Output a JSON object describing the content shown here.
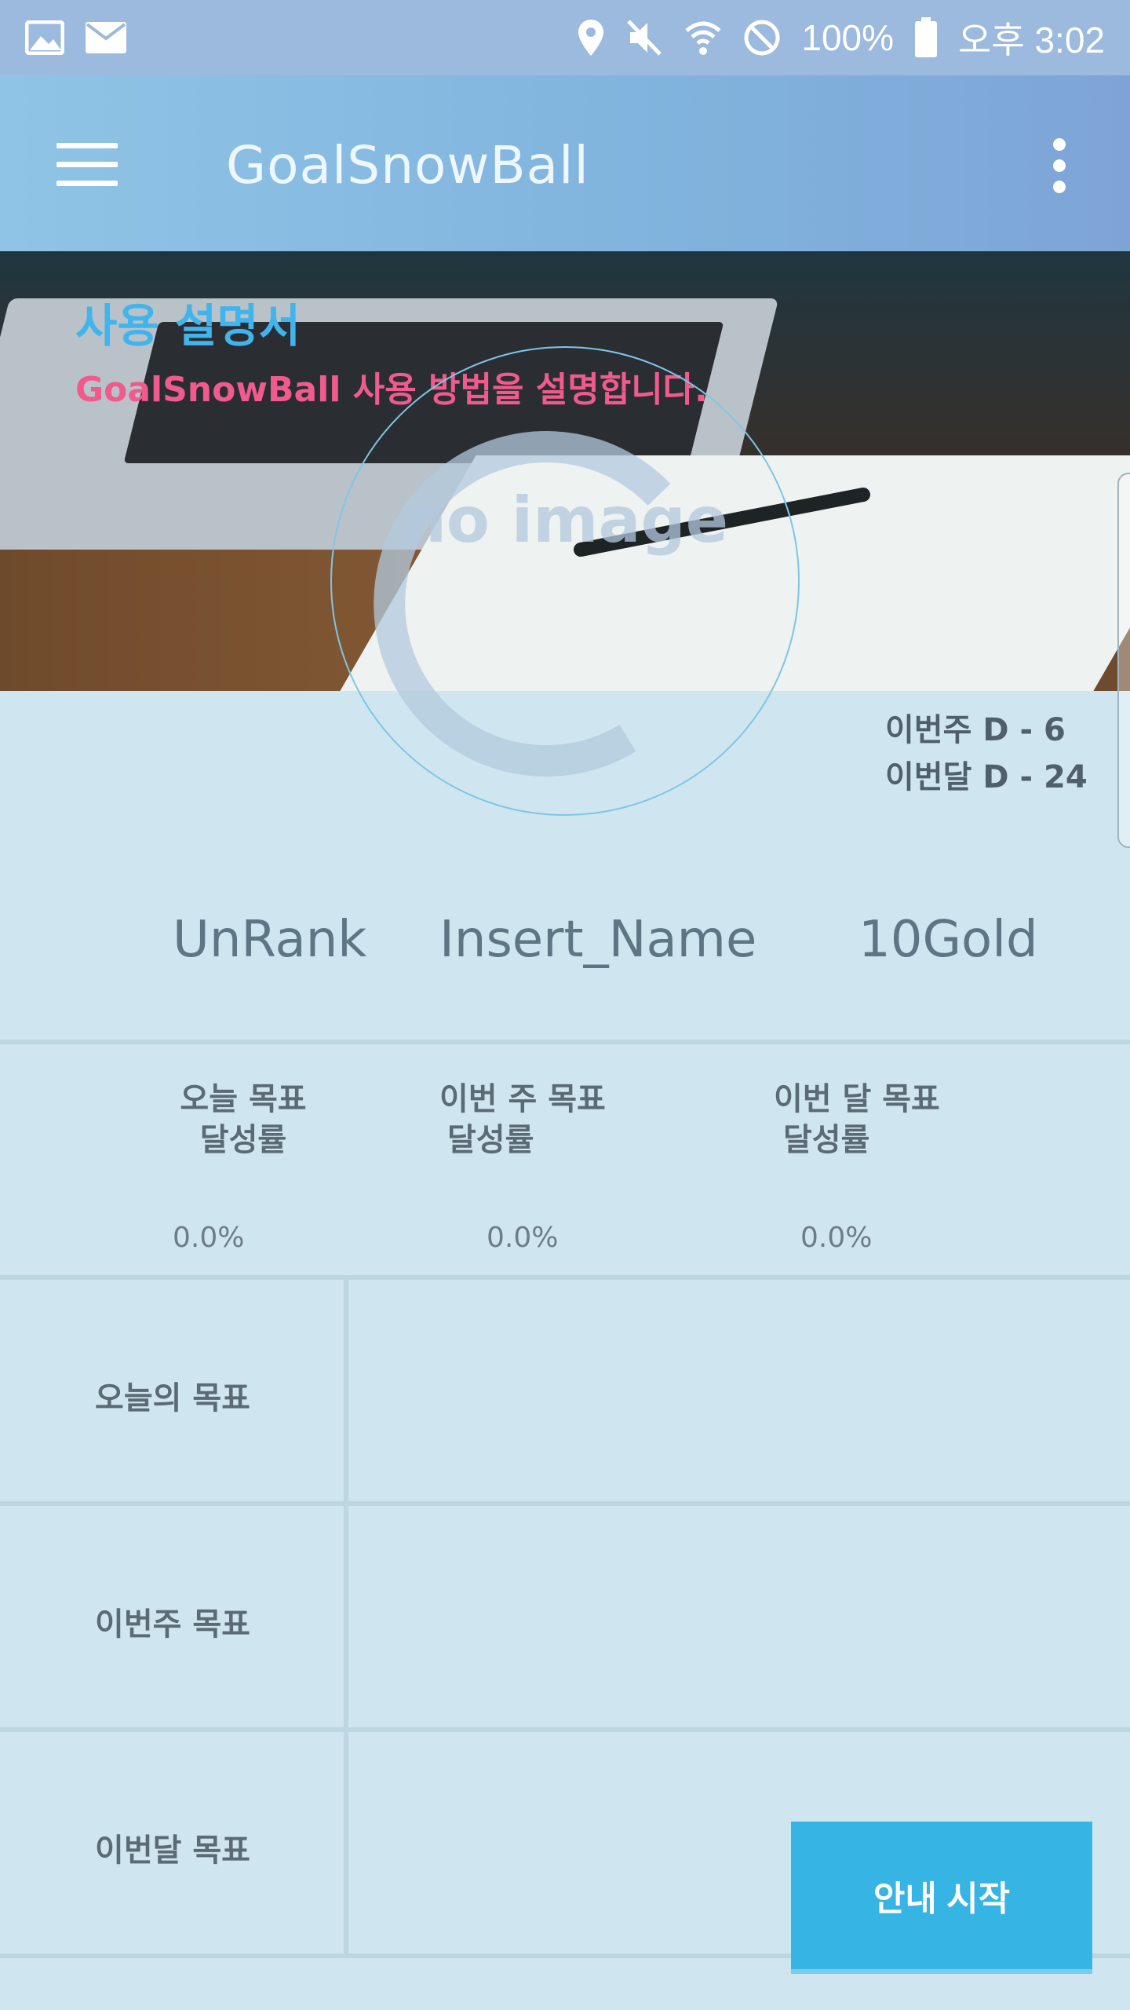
{
  "status_bar": {
    "battery_text": "100%",
    "time_text": "오후 3:02",
    "icons": [
      "gallery-icon",
      "mail-icon",
      "location-icon",
      "mute-icon",
      "wifi-icon",
      "block-icon",
      "battery-icon"
    ]
  },
  "app_bar": {
    "title": "GoalSnowBall",
    "menu_icon": "hamburger-menu-icon",
    "overflow_icon": "more-vert-icon"
  },
  "banner": {
    "title": "사용 설명서",
    "subtitle": "GoalSnowBall 사용 방법을 설명합니다.",
    "placeholder_text": "no image"
  },
  "dday": {
    "week": "이번주  D - 6",
    "month": "이번달  D - 24"
  },
  "profile": {
    "rank": "UnRank",
    "name": "Insert_Name",
    "gold": "10Gold"
  },
  "rates": [
    {
      "label_line1": "오늘 목표",
      "label_line2": "달성률",
      "value": "0.0%"
    },
    {
      "label_line1": "이번 주 목표",
      "label_line2": "달성률",
      "value": "0.0%"
    },
    {
      "label_line1": "이번 달 목표",
      "label_line2": "달성률",
      "value": "0.0%"
    }
  ],
  "goals": [
    {
      "label": "오늘의 목표",
      "value": ""
    },
    {
      "label": "이번주 목표",
      "value": ""
    },
    {
      "label": "이번달 목표",
      "value": ""
    }
  ],
  "button": {
    "start_label": "안내 시작"
  },
  "colors": {
    "accent": "#36b4e4",
    "banner_title": "#42b4ec",
    "banner_subtitle": "#f05a8c",
    "background": "#cfe6f0"
  }
}
